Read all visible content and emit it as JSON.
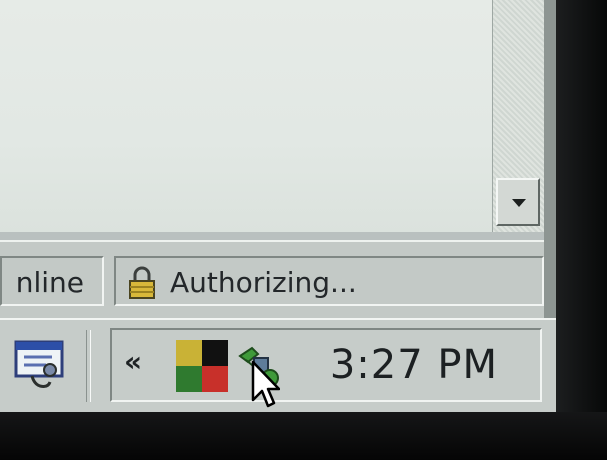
{
  "status_bar": {
    "zone_text": "nline",
    "status_text": "Authorizing..."
  },
  "taskbar": {
    "tray_expand": "«",
    "clock": "3:27 PM"
  },
  "icons": {
    "scroll_down": "chevron-down-icon",
    "lock": "lock-icon",
    "quick_launch": "show-desktop-icon",
    "flag": "windows-flag-icon",
    "network": "network-icon",
    "cursor": "mouse-cursor-icon"
  },
  "colors": {
    "flag_yellow": "#c9b236",
    "flag_black": "#111111",
    "flag_green": "#2f7a2f",
    "flag_red": "#c8302a",
    "network_green": "#3f9a3a",
    "status_bar": "#c3c9c6",
    "content_bg": "#e4e9e5"
  }
}
